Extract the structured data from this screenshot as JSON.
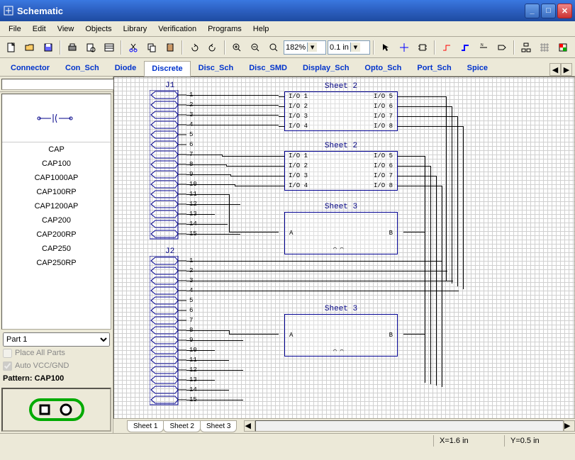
{
  "window": {
    "title": "Schematic"
  },
  "menu": [
    "File",
    "Edit",
    "View",
    "Objects",
    "Library",
    "Verification",
    "Programs",
    "Help"
  ],
  "toolbar": {
    "zoom": "182%",
    "grid": "0.1 in"
  },
  "libtabs": [
    "Connector",
    "Con_Sch",
    "Diode",
    "Discrete",
    "Disc_Sch",
    "Disc_SMD",
    "Display_Sch",
    "Opto_Sch",
    "Port_Sch",
    "Spice"
  ],
  "libtabs_active": 3,
  "sidebar": {
    "items": [
      "CAP",
      "CAP100",
      "CAP1000AP",
      "CAP100RP",
      "CAP1200AP",
      "CAP200",
      "CAP200RP",
      "CAP250",
      "CAP250RP"
    ],
    "part_dropdown": "Part 1",
    "place_all": "Place All Parts",
    "auto_vcc": "Auto VCC/GND",
    "pattern_label": "Pattern: CAP100"
  },
  "schematic": {
    "j1": {
      "label": "J1",
      "pins": [
        "1",
        "2",
        "3",
        "4",
        "5",
        "6",
        "7",
        "8",
        "9",
        "10",
        "11",
        "12",
        "13",
        "14",
        "15"
      ]
    },
    "j2": {
      "label": "J2",
      "pins": [
        "1",
        "2",
        "3",
        "4",
        "5",
        "6",
        "7",
        "8",
        "9",
        "10",
        "11",
        "12",
        "13",
        "14",
        "15"
      ]
    },
    "sheet2a": {
      "title": "Sheet 2",
      "left": [
        "I/O 1",
        "I/O 2",
        "I/O 3",
        "I/O 4"
      ],
      "right": [
        "I/O 5",
        "I/O 6",
        "I/O 7",
        "I/O 8"
      ]
    },
    "sheet2b": {
      "title": "Sheet 2",
      "left": [
        "I/O 1",
        "I/O 2",
        "I/O 3",
        "I/O 4"
      ],
      "right": [
        "I/O 5",
        "I/O 6",
        "I/O 7",
        "I/O 8"
      ]
    },
    "sheet3a": {
      "title": "Sheet 3",
      "A": "A",
      "B": "B"
    },
    "sheet3b": {
      "title": "Sheet 3",
      "A": "A",
      "B": "B"
    }
  },
  "sheet_tabs": [
    "Sheet 1",
    "Sheet 2",
    "Sheet 3"
  ],
  "sheet_active": 0,
  "status": {
    "x": "X=1.6 in",
    "y": "Y=0.5 in"
  }
}
